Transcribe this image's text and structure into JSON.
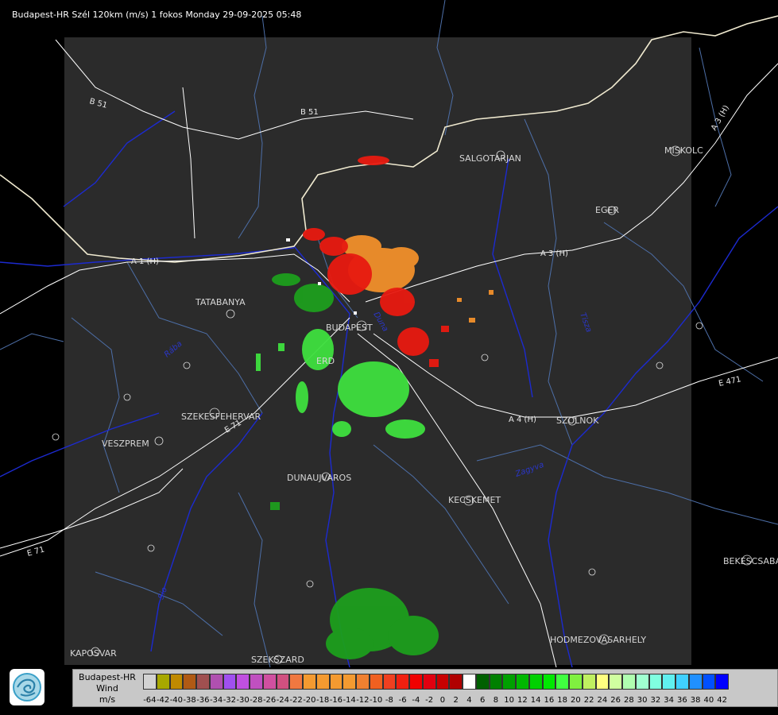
{
  "header": {
    "title": "Budapest-HR Szél 120km (m/s) 1 fokos Monday 29-09-2025 05:48"
  },
  "map": {
    "cities": [
      {
        "name": "SALGÓTARJÁN",
        "label": "SALGOTARJAN"
      },
      {
        "name": "MISKOLC",
        "label": "MISKOLC"
      },
      {
        "name": "EGER",
        "label": "EGER"
      },
      {
        "name": "TATABÁNYA",
        "label": "TATABANYA"
      },
      {
        "name": "BUDAPEST",
        "label": "BUDAPEST"
      },
      {
        "name": "ÉRD",
        "label": "ERD"
      },
      {
        "name": "SZÉKESFEHÉRVÁR",
        "label": "SZEKESFEHERVAR"
      },
      {
        "name": "VESZPRÉM",
        "label": "VESZPREM"
      },
      {
        "name": "DUNAÚJVÁROS",
        "label": "DUNAUJVAROS"
      },
      {
        "name": "KECSKEMÉT",
        "label": "KECSKEMET"
      },
      {
        "name": "SZOLNOK",
        "label": "SZOLNOK"
      },
      {
        "name": "BÉKÉSCSABA",
        "label": "BEKESCSABA"
      },
      {
        "name": "HÓDMEZŐVÁSÁRHELY",
        "label": "HODMEZOVASARHELY"
      },
      {
        "name": "KAPOSVÁR",
        "label": "KAPOSVAR"
      },
      {
        "name": "SZEKSZÁRD",
        "label": "SZEKSZARD"
      }
    ],
    "roads": [
      "B 51",
      "B 51",
      "A 3 (H)",
      "A 3 (H)",
      "A 1 (H)",
      "A 4 (H)",
      "E 471",
      "E 71",
      "E 71"
    ],
    "rivers": [
      "Duna",
      "Tisza",
      "Zagyva",
      "Sio",
      "Rába"
    ]
  },
  "legend": {
    "title_lines": [
      "Budapest-HR",
      "Wind",
      "m/s"
    ],
    "colors": [
      "#d3d3d3",
      "#a8a800",
      "#c08a00",
      "#b05a14",
      "#a05050",
      "#b050b0",
      "#a050f0",
      "#c050e0",
      "#c050c0",
      "#d050a0",
      "#d05080",
      "#f07840",
      "#f49a30",
      "#f49a30",
      "#f49a30",
      "#f49a30",
      "#f08030",
      "#f06020",
      "#f04020",
      "#f02010",
      "#f00000",
      "#e00010",
      "#c80000",
      "#b00000",
      "#ffffff",
      "#006000",
      "#008000",
      "#00a000",
      "#00b800",
      "#00d000",
      "#00e800",
      "#40ff40",
      "#80f040",
      "#c0f060",
      "#ffff80",
      "#d0ffa0",
      "#b0ffb0",
      "#a0ffd0",
      "#80ffe0",
      "#60f0f0",
      "#40d0ff",
      "#2090ff",
      "#0050ff",
      "#0000ff"
    ],
    "ticks": [
      "-64",
      "-42",
      "-40",
      "-38",
      "-36",
      "-34",
      "-32",
      "-30",
      "-28",
      "-26",
      "-24",
      "-22",
      "-20",
      "-18",
      "-16",
      "-14",
      "-12",
      "-10",
      "-8",
      "-6",
      "-4",
      "-2",
      "0",
      "2",
      "4",
      "6",
      "8",
      "10",
      "12",
      "14",
      "16",
      "18",
      "20",
      "22",
      "24",
      "26",
      "28",
      "30",
      "32",
      "34",
      "36",
      "38",
      "40",
      "42"
    ]
  },
  "logo": {
    "icon": "omsz-logo-icon"
  }
}
